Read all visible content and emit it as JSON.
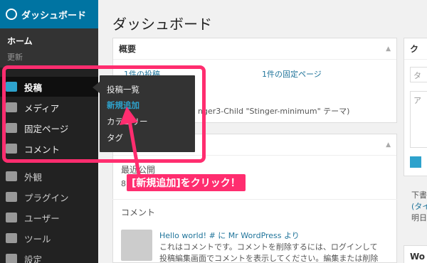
{
  "sidebar": {
    "dashboard_label": "ダッシュボード",
    "home_label": "ホーム",
    "update_label": "更新",
    "items": [
      {
        "label": "投稿"
      },
      {
        "label": "メディア"
      },
      {
        "label": "固定ページ"
      },
      {
        "label": "コメント"
      },
      {
        "label": "外観"
      },
      {
        "label": "プラグイン"
      },
      {
        "label": "ユーザー"
      },
      {
        "label": "ツール"
      },
      {
        "label": "設定"
      }
    ]
  },
  "flyout": {
    "items": [
      "投稿一覧",
      "新規追加",
      "カテゴリー",
      "タグ"
    ]
  },
  "main": {
    "page_title": "ダッシュボード",
    "overview": {
      "title": "概要",
      "posts_count": "1件の投稿",
      "pages_count": "1件の固定ページ",
      "theme_text": "nger3-Child \"Stinger-minimum\" テーマ)"
    },
    "activity": {
      "recent_label": "最近公開",
      "recent_num": "8",
      "comments_label": "コメント",
      "comment_link": "Hello world! # に Mr WordPress より",
      "comment_line1": "これはコメントです。コメントを削除するには、ログインして",
      "comment_line2": "投稿編集画面でコメントを表示してください。編集または削除"
    },
    "right": {
      "title_fragment": "ク",
      "input_fragment": "タ",
      "text_fragment": "ア",
      "draft_label": "下書",
      "draft_link": "(タイ",
      "draft_date": "明日",
      "bottom_label": "Wo"
    }
  },
  "callout": {
    "text": "[新規追加]をクリック！"
  },
  "colors": {
    "highlight": "#ff2d6f",
    "accent": "#0074a2",
    "sidebar_bg": "#222222"
  }
}
